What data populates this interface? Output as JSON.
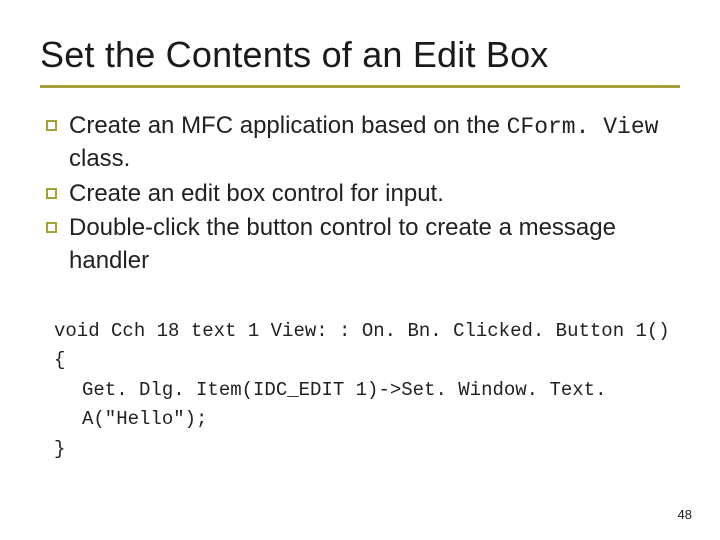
{
  "title": "Set the Contents of an Edit Box",
  "bullets": [
    {
      "pre": "Create an MFC application based on the ",
      "mono": "CForm. View",
      "post": " class."
    },
    {
      "pre": "Create an edit box control for input.",
      "mono": "",
      "post": ""
    },
    {
      "pre": "Double-click the button control to create a message handler",
      "mono": "",
      "post": ""
    }
  ],
  "code": {
    "l1": "void Cch 18 text 1 View: : On. Bn. Clicked. Button 1()",
    "l2": "{",
    "l3": "Get. Dlg. Item(IDC_EDIT 1)->Set. Window. Text. A(\"Hello\");",
    "l4": "}"
  },
  "page_number": "48"
}
